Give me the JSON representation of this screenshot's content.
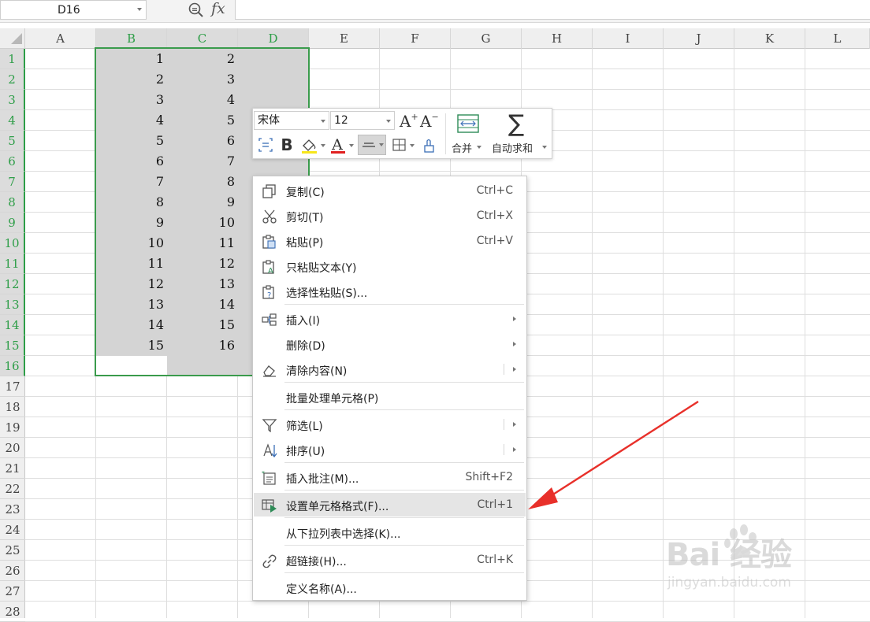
{
  "formula_bar": {
    "cell_ref": "D16",
    "fx_label": "fx",
    "formula": ""
  },
  "columns": [
    {
      "label": "A",
      "selected": false
    },
    {
      "label": "B",
      "selected": true
    },
    {
      "label": "C",
      "selected": true
    },
    {
      "label": "D",
      "selected": true
    },
    {
      "label": "E",
      "selected": false
    },
    {
      "label": "F",
      "selected": false
    },
    {
      "label": "G",
      "selected": false
    },
    {
      "label": "H",
      "selected": false
    },
    {
      "label": "I",
      "selected": false
    },
    {
      "label": "J",
      "selected": false
    },
    {
      "label": "K",
      "selected": false
    },
    {
      "label": "L",
      "selected": false
    }
  ],
  "rows": [
    "1",
    "2",
    "3",
    "4",
    "5",
    "6",
    "7",
    "8",
    "9",
    "10",
    "11",
    "12",
    "13",
    "14",
    "15",
    "16",
    "17",
    "18",
    "19",
    "20",
    "21",
    "22",
    "23",
    "24",
    "25",
    "26",
    "27",
    "28"
  ],
  "selected_rows": 16,
  "cells": {
    "B": [
      "1",
      "2",
      "3",
      "4",
      "5",
      "6",
      "7",
      "8",
      "9",
      "10",
      "11",
      "12",
      "13",
      "14",
      "15"
    ],
    "C": [
      "2",
      "3",
      "4",
      "5",
      "6",
      "7",
      "8",
      "9",
      "10",
      "11",
      "12",
      "13",
      "14",
      "15",
      "16"
    ]
  },
  "mini_toolbar": {
    "font_name": "宋体",
    "font_size": "12",
    "increase_font": "A",
    "decrease_font": "A",
    "bold": "B",
    "font_color_letter": "A",
    "merge_label": "合并",
    "autosum_label": "自动求和",
    "sigma": "∑",
    "font_color": "#e02020",
    "fill_color": "#f7e61a"
  },
  "context_menu": {
    "items": [
      {
        "label": "复制(C)",
        "shortcut": "Ctrl+C",
        "icon": "copy-icon"
      },
      {
        "label": "剪切(T)",
        "shortcut": "Ctrl+X",
        "icon": "scissors-icon"
      },
      {
        "label": "粘贴(P)",
        "shortcut": "Ctrl+V",
        "icon": "paste-icon"
      },
      {
        "label": "只粘贴文本(Y)",
        "shortcut": "",
        "icon": "paste-text-icon"
      },
      {
        "label": "选择性粘贴(S)...",
        "shortcut": "",
        "icon": "paste-special-icon"
      },
      {
        "label": "插入(I)",
        "shortcut": "",
        "icon": "insert-icon"
      },
      {
        "label": "删除(D)",
        "shortcut": "",
        "icon": ""
      },
      {
        "label": "清除内容(N)",
        "shortcut": "",
        "icon": "eraser-icon"
      },
      {
        "label": "批量处理单元格(P)",
        "shortcut": "",
        "icon": ""
      },
      {
        "label": "筛选(L)",
        "shortcut": "",
        "icon": "filter-icon"
      },
      {
        "label": "排序(U)",
        "shortcut": "",
        "icon": "sort-icon"
      },
      {
        "label": "插入批注(M)...",
        "shortcut": "Shift+F2",
        "icon": "comment-icon"
      },
      {
        "label": "设置单元格格式(F)...",
        "shortcut": "Ctrl+1",
        "icon": "format-cells-icon"
      },
      {
        "label": "从下拉列表中选择(K)...",
        "shortcut": "",
        "icon": ""
      },
      {
        "label": "超链接(H)...",
        "shortcut": "Ctrl+K",
        "icon": "link-icon"
      },
      {
        "label": "定义名称(A)...",
        "shortcut": "",
        "icon": ""
      }
    ],
    "highlighted_index": 12
  },
  "watermark": {
    "brand": "Bai 经验",
    "url": "jingyan.baidu.com"
  },
  "colors": {
    "selection_border": "#3a9b4c",
    "selection_fill": "#d4d4d4",
    "arrow": "#e8302a",
    "highlight": "#e5e5e5"
  }
}
